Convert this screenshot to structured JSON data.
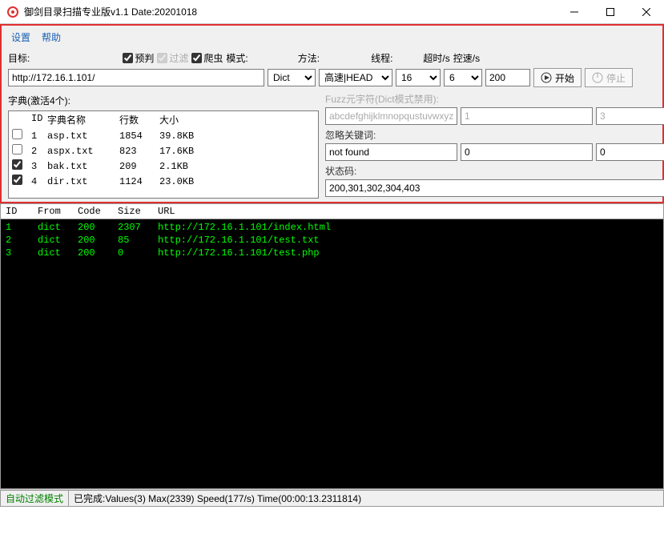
{
  "window": {
    "title": "御剑目录扫描专业版v1.1 Date:20201018"
  },
  "menu": {
    "settings": "设置",
    "help": "帮助"
  },
  "labels": {
    "target": "目标:",
    "prejudge": "预判",
    "filter": "过滤",
    "spider": "爬虫",
    "mode": "模式:",
    "method": "方法:",
    "threads": "线程:",
    "timeout": "超时/s",
    "speed_limit": "控速/s"
  },
  "values": {
    "target_url": "http://172.16.1.101/",
    "mode": "Dict",
    "method": "高速|HEAD",
    "threads": "16",
    "timeout": "6",
    "speed": "200",
    "start_label": "开始",
    "stop_label": "停止"
  },
  "dict": {
    "header": "字典(激活4个):",
    "cols": {
      "id": "ID",
      "name": "字典名称",
      "lines": "行数",
      "size": "大小"
    },
    "items": [
      {
        "checked": false,
        "id": "1",
        "name": "asp.txt",
        "lines": "1854",
        "size": "39.8KB"
      },
      {
        "checked": false,
        "id": "2",
        "name": "aspx.txt",
        "lines": "823",
        "size": "17.6KB"
      },
      {
        "checked": true,
        "id": "3",
        "name": "bak.txt",
        "lines": "209",
        "size": "2.1KB"
      },
      {
        "checked": true,
        "id": "4",
        "name": "dir.txt",
        "lines": "1124",
        "size": "23.0KB"
      }
    ]
  },
  "right": {
    "fuzz_label": "Fuzz元字符(Dict模式禁用):",
    "fuzz_value": "abcdefghijklmnopqustuvwxyz",
    "fuzz_min": "1",
    "fuzz_max": "3",
    "ignore_label": "忽略关键词:",
    "ignore_value": "not found",
    "ignore_n1": "0",
    "ignore_n2": "0",
    "status_label": "状态码:",
    "status_value": "200,301,302,304,403"
  },
  "results": {
    "cols": {
      "id": "ID",
      "from": "From",
      "code": "Code",
      "size": "Size",
      "url": "URL"
    },
    "rows": [
      {
        "id": "1",
        "from": "dict",
        "code": "200",
        "size": "2307",
        "url": "http://172.16.1.101/index.html"
      },
      {
        "id": "2",
        "from": "dict",
        "code": "200",
        "size": "85",
        "url": "http://172.16.1.101/test.txt"
      },
      {
        "id": "3",
        "from": "dict",
        "code": "200",
        "size": "0",
        "url": "http://172.16.1.101/test.php"
      }
    ]
  },
  "status": {
    "mode": "自动过滤模式",
    "text": "已完成:Values(3) Max(2339) Speed(177/s) Time(00:00:13.2311814)"
  }
}
